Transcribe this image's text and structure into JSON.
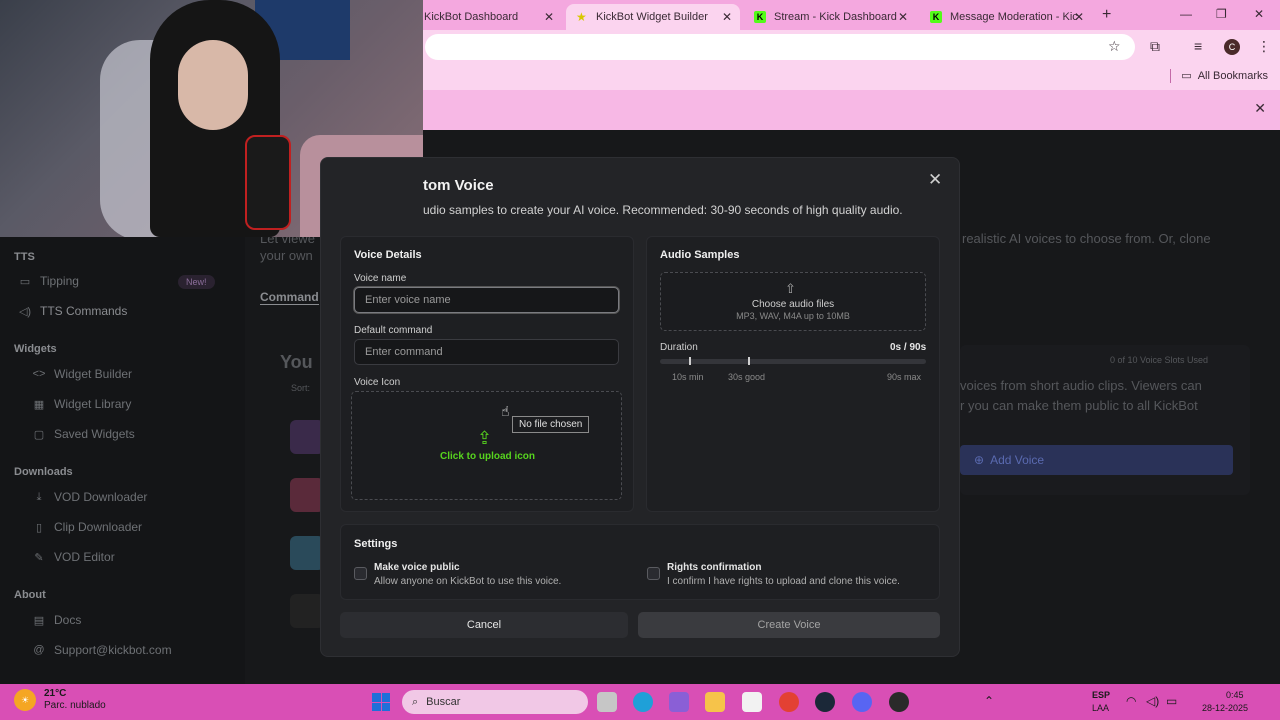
{
  "browser": {
    "tabs": [
      {
        "label": "KickBot Dashboard",
        "active": false
      },
      {
        "label": "KickBot Widget Builder",
        "active": true
      },
      {
        "label": "Stream - Kick Dashboard",
        "active": false
      },
      {
        "label": "Message Moderation - Kic",
        "active": false
      }
    ],
    "all_bookmarks": "All Bookmarks",
    "profile_initial": "C"
  },
  "sidebar": {
    "tts_heading": "TTS",
    "tipping": "Tipping",
    "new_badge": "New!",
    "tts_commands": "TTS Commands",
    "widgets_heading": "Widgets",
    "widget_builder": "Widget Builder",
    "widget_library": "Widget Library",
    "saved_widgets": "Saved Widgets",
    "downloads_heading": "Downloads",
    "vod_downloader": "VOD Downloader",
    "clip_downloader": "Clip Downloader",
    "vod_editor": "VOD Editor",
    "about_heading": "About",
    "docs": "Docs",
    "support": "Support@kickbot.com"
  },
  "background": {
    "intro_partial_1": "Let viewe",
    "intro_partial_2": "your own",
    "commands_tab": "Command",
    "your_heading": "You",
    "sort": "Sort:",
    "right_text": "realistic AI voices to choose from. Or, clone",
    "slots": "0 of 10 Voice Slots Used",
    "voices_line1": "voices from short audio clips. Viewers can",
    "voices_line2": "r you can make them public to all KickBot",
    "add_voice": "Add Voice"
  },
  "modal": {
    "title": "tom Voice",
    "subtitle": "udio samples to create your AI voice. Recommended: 30-90 seconds of high quality audio.",
    "voice_details": {
      "heading": "Voice Details",
      "name_label": "Voice name",
      "name_placeholder": "Enter voice name",
      "command_label": "Default command",
      "command_placeholder": "Enter command",
      "icon_label": "Voice Icon",
      "upload_text": "Click to upload icon",
      "tooltip": "No file chosen"
    },
    "audio_samples": {
      "heading": "Audio Samples",
      "choose": "Choose audio files",
      "formats": "MP3, WAV, M4A up to 10MB",
      "duration_label": "Duration",
      "duration_value": "0s / 90s",
      "min_label": "10s min",
      "good_label": "30s good",
      "max_label": "90s max"
    },
    "settings": {
      "heading": "Settings",
      "public_title": "Make voice public",
      "public_desc": "Allow anyone on KickBot to use this voice.",
      "rights_title": "Rights confirmation",
      "rights_desc": "I confirm I have rights to upload and clone this voice."
    },
    "cancel": "Cancel",
    "create": "Create Voice"
  },
  "taskbar": {
    "temp": "21°C",
    "weather": "Parc. nublado",
    "search": "Buscar",
    "lang1": "ESP",
    "lang2": "LAA",
    "time": "0:45",
    "date": "28-12-2025"
  }
}
